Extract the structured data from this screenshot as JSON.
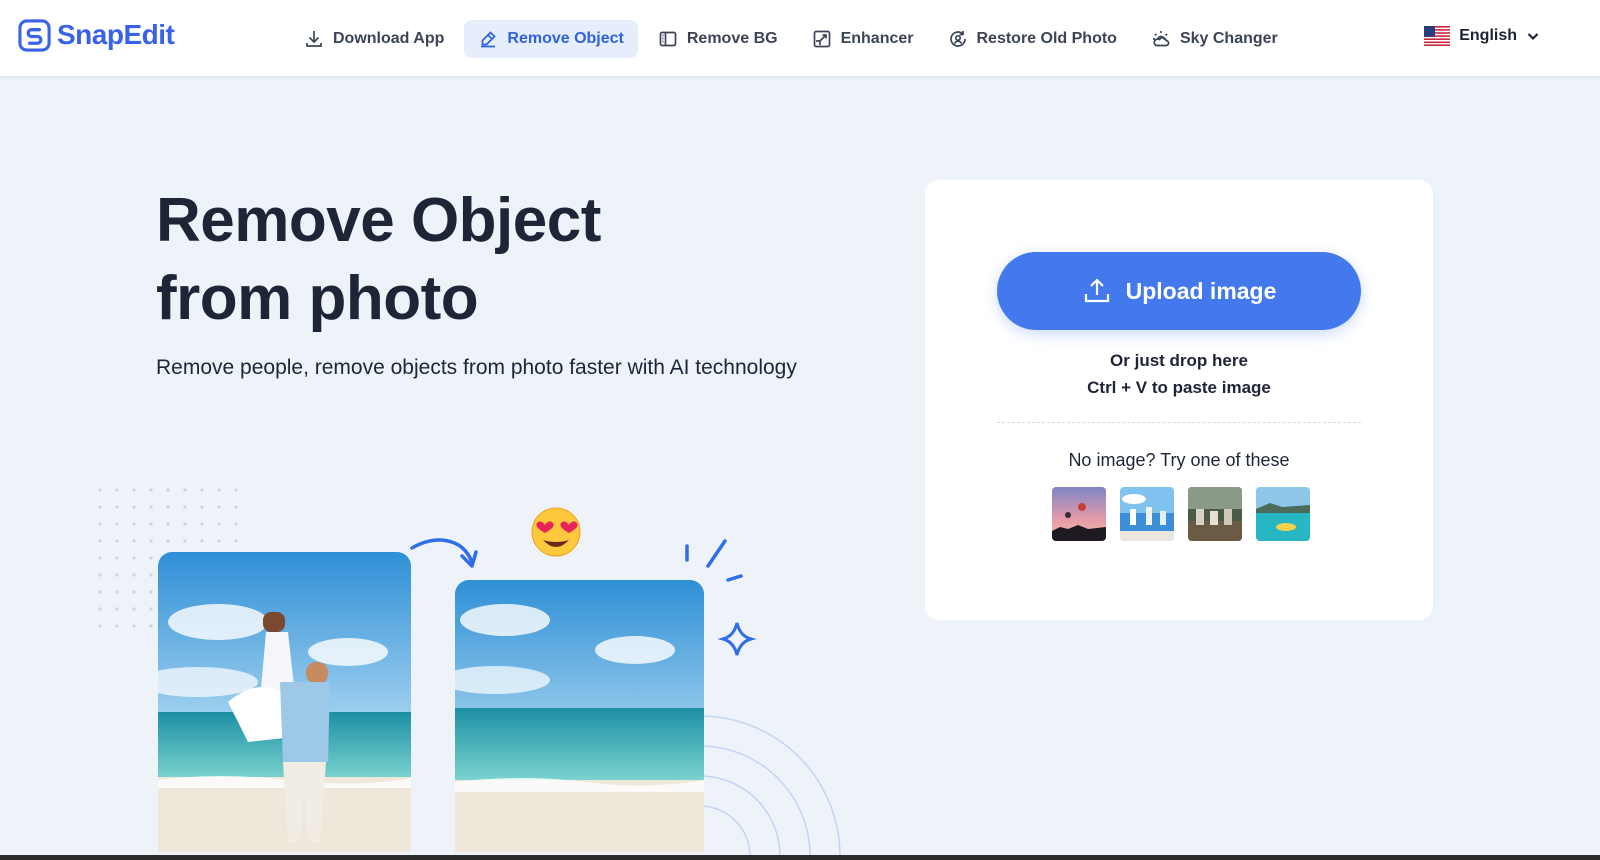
{
  "brand": {
    "name": "SnapEdit",
    "color": "#3a62e8"
  },
  "nav": {
    "items": [
      {
        "label": "Download App",
        "icon": "download-icon"
      },
      {
        "label": "Remove Object",
        "icon": "eraser-icon",
        "active": true
      },
      {
        "label": "Remove BG",
        "icon": "remove-bg-icon"
      },
      {
        "label": "Enhancer",
        "icon": "enhance-icon"
      },
      {
        "label": "Restore Old Photo",
        "icon": "restore-icon"
      },
      {
        "label": "Sky Changer",
        "icon": "sky-icon"
      }
    ],
    "language": {
      "label": "English",
      "icon": "us-flag-icon"
    }
  },
  "hero": {
    "title_line1": "Remove Object",
    "title_line2": "from photo",
    "subtitle": "Remove people, remove objects from photo faster with AI technology",
    "highlight_color": "#2ef0e6"
  },
  "upload": {
    "button_label": "Upload image",
    "drop_hint": "Or just drop here",
    "paste_hint": "Ctrl + V to paste image",
    "samples_label": "No image? Try one of these",
    "samples": [
      "sample-sunset-balloons",
      "sample-beach-people",
      "sample-group-garden",
      "sample-tropical-island"
    ],
    "accent": "#4379ec"
  }
}
